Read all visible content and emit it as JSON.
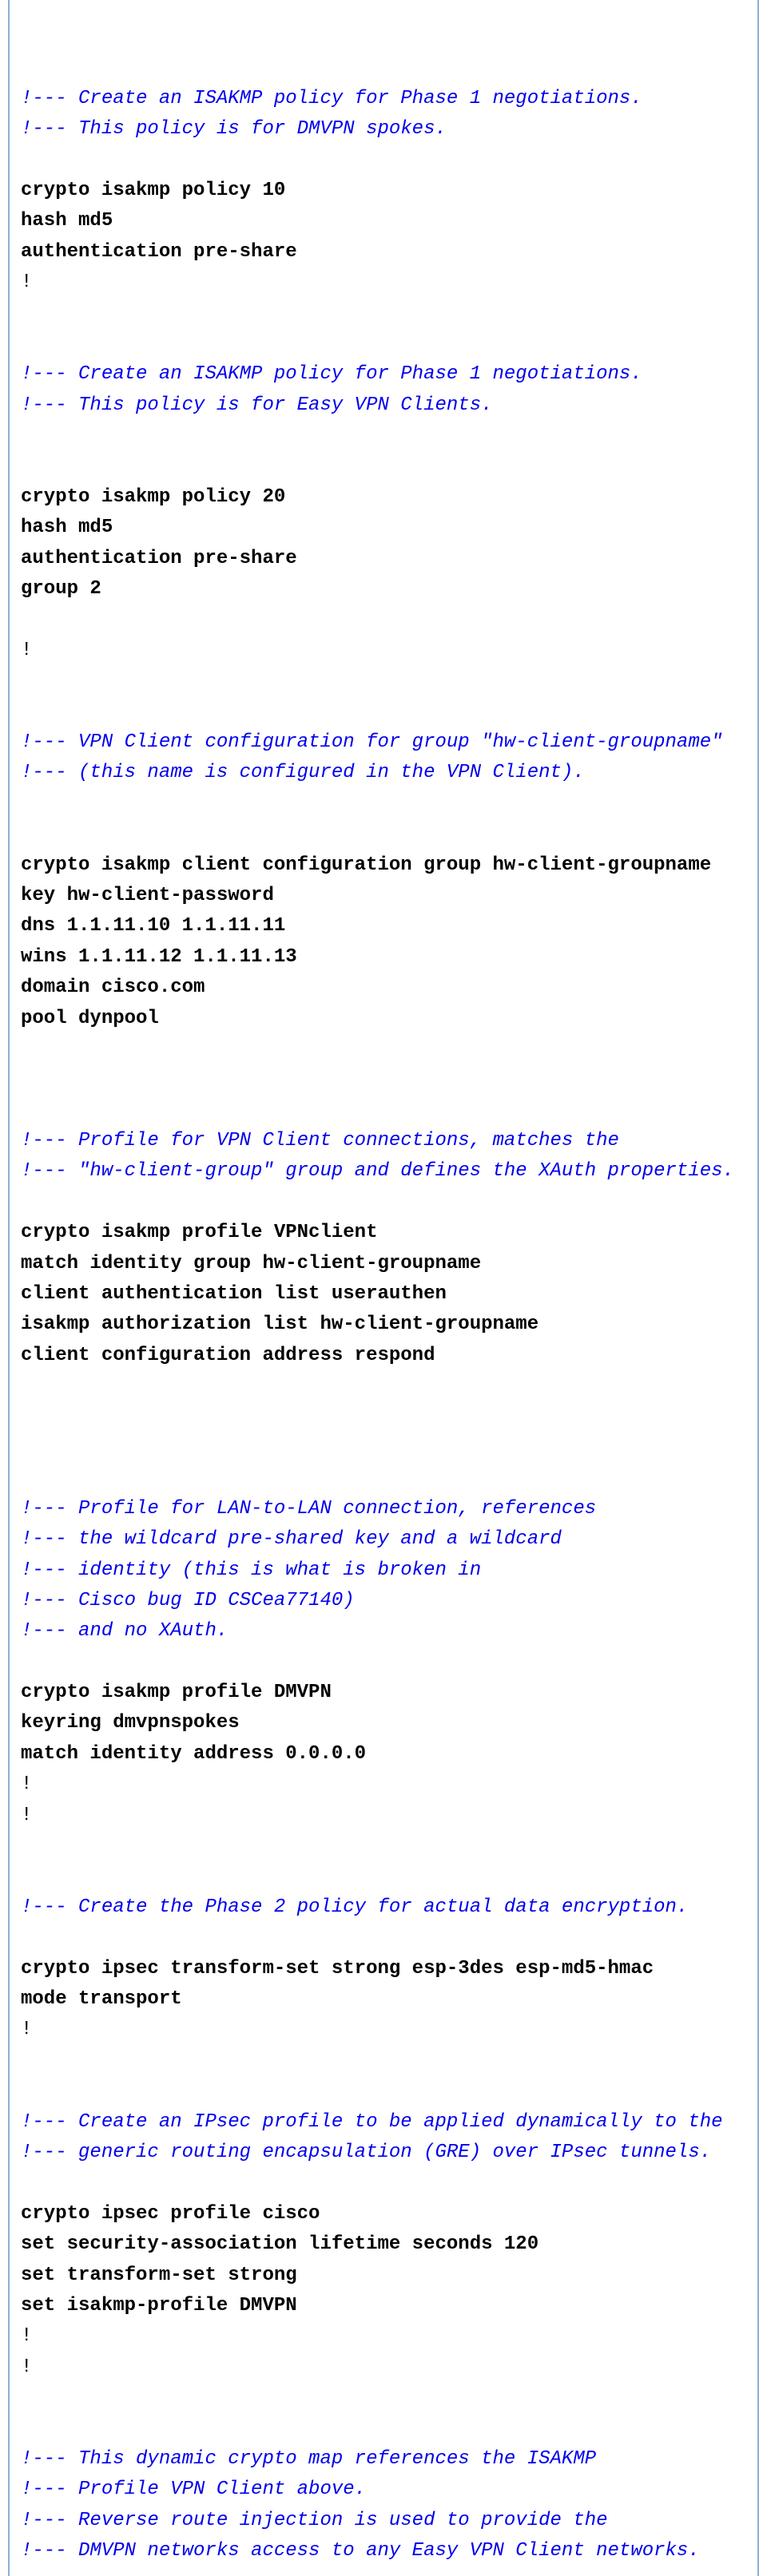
{
  "sections": [
    {
      "type": "comment",
      "lines": [
        "!--- Create an ISAKMP policy for Phase 1 negotiations.",
        "!--- This policy is for DMVPN spokes."
      ]
    },
    {
      "type": "config",
      "lines": [
        "crypto isakmp policy 10",
        "hash md5",
        "authentication pre-share",
        "!"
      ]
    },
    {
      "type": "comment",
      "lines": [
        "!--- Create an ISAKMP policy for Phase 1 negotiations.",
        "!--- This policy is for Easy VPN Clients."
      ]
    },
    {
      "type": "config",
      "lines": [
        "crypto isakmp policy 20",
        "hash md5",
        "authentication pre-share",
        "group 2",
        "!"
      ]
    },
    {
      "type": "comment",
      "lines": [
        "!--- VPN Client configuration for group \"hw-client-groupname\"",
        "!--- (this name is configured in the VPN Client)."
      ]
    },
    {
      "type": "config",
      "lines": [
        "crypto isakmp client configuration group hw-client-groupname",
        "key hw-client-password",
        "dns 1.1.11.10 1.1.11.11",
        "wins 1.1.11.12 1.1.11.13",
        "domain cisco.com",
        "pool dynpool"
      ]
    },
    {
      "type": "comment",
      "lines": [
        "!--- Profile for VPN Client connections, matches the",
        "!--- \"hw-client-group\" group and defines the XAuth properties."
      ]
    },
    {
      "type": "config",
      "lines": [
        "crypto isakmp profile VPNclient",
        "match identity group hw-client-groupname",
        "client authentication list userauthen",
        "isakmp authorization list hw-client-groupname",
        "client configuration address respond"
      ]
    },
    {
      "type": "comment",
      "lines": [
        "!--- Profile for LAN-to-LAN connection, references",
        "!--- the wildcard pre-shared key and a wildcard",
        "!--- identity (this is what is broken in",
        "!--- Cisco bug ID CSCea77140)",
        "!--- and no XAuth."
      ]
    },
    {
      "type": "config",
      "lines": [
        "crypto isakmp profile DMVPN",
        "keyring dmvpnspokes",
        "match identity address 0.0.0.0",
        "!",
        "!"
      ]
    },
    {
      "type": "comment",
      "lines": [
        "!--- Create the Phase 2 policy for actual data encryption."
      ]
    },
    {
      "type": "config",
      "lines": [
        "crypto ipsec transform-set strong esp-3des esp-md5-hmac",
        "mode transport",
        "!"
      ]
    },
    {
      "type": "comment",
      "lines": [
        "!--- Create an IPsec profile to be applied dynamically to the",
        "!--- generic routing encapsulation (GRE) over IPsec tunnels."
      ]
    },
    {
      "type": "config",
      "lines": [
        "crypto ipsec profile cisco",
        "set security-association lifetime seconds 120",
        "set transform-set strong",
        "set isakmp-profile DMVPN",
        "!",
        "!"
      ]
    },
    {
      "type": "comment",
      "lines": [
        "!--- This dynamic crypto map references the ISAKMP",
        "!--- Profile VPN Client above.",
        "!--- Reverse route injection is used to provide the",
        "!--- DMVPN networks access to any Easy VPN Client networks."
      ]
    }
  ]
}
